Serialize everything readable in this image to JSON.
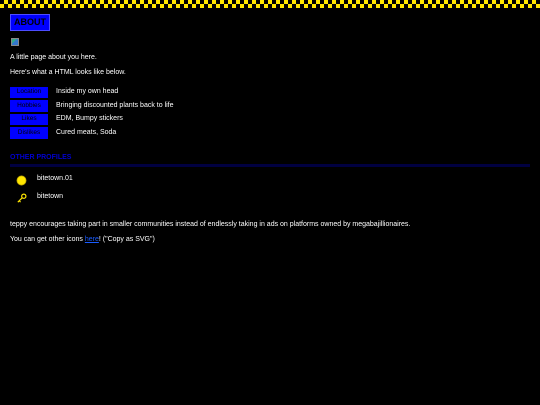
{
  "title": "ABOUT",
  "intro": "A little page about you here.",
  "table_intro": "Here's what a HTML looks like below.",
  "info_rows": [
    {
      "key": "Location",
      "value": "Inside my own head"
    },
    {
      "key": "Hobbies",
      "value": "Bringing discounted plants back to life"
    },
    {
      "key": "Likes",
      "value": "EDM, Bumpy stickers"
    },
    {
      "key": "Dislikes",
      "value": "Cured meats, Soda"
    }
  ],
  "other_profiles_heading": "OTHER PROFILES",
  "profiles": [
    {
      "name": "bitetown.01",
      "icon": "yellow-circle-icon"
    },
    {
      "name": "bitetown",
      "icon": "key-icon"
    }
  ],
  "footer_text": "teppy encourages taking part in smaller communities instead of endlessly taking in ads on platforms owned by megabajillionaires.",
  "icons_prefix": "You can get other icons",
  "icons_link": "here",
  "icons_suffix": "! (\"Copy as SVG\")",
  "colors": {
    "accent": "#0000ff",
    "checker": "#ffe600",
    "background": "#000000",
    "link": "#1a5cff"
  }
}
